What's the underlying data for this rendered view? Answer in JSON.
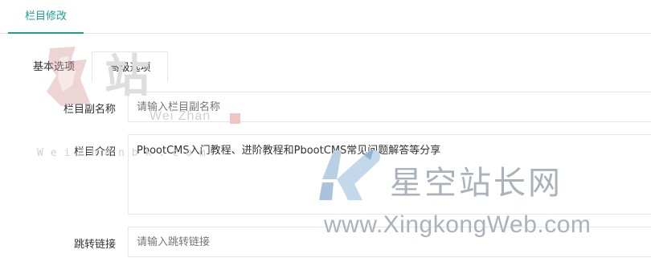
{
  "header": {
    "tab_label": "栏目修改"
  },
  "tabs": [
    {
      "label": "基本选项",
      "active": false
    },
    {
      "label": "高级选项",
      "active": true
    }
  ],
  "form": {
    "subname": {
      "label": "栏目副名称",
      "placeholder": "请输入栏目副名称",
      "value": ""
    },
    "description": {
      "label": "栏目介绍",
      "value": "PbootCMS入门教程、进阶教程和PbootCMS常见问题解答等分享"
    },
    "outlink": {
      "label": "跳转链接",
      "placeholder": "请输入跳转链接",
      "value": ""
    }
  },
  "watermarks": {
    "weizhan": {
      "big": "站",
      "sub": "Wei Zhan",
      "url": "WeiZhanbk.com"
    },
    "xingkong": {
      "title": "星空站长网",
      "url": "www.XingkongWeb.com"
    }
  },
  "colors": {
    "accent": "#1aa094",
    "border": "#e6e6e6"
  }
}
